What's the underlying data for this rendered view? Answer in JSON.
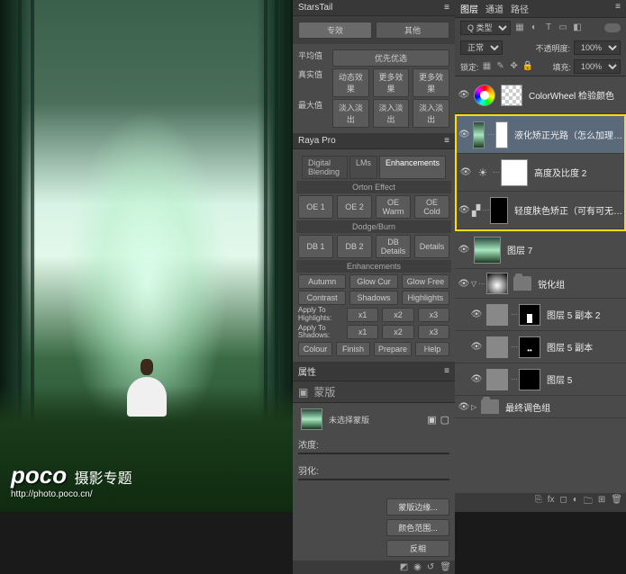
{
  "watermark": {
    "brand": "poco",
    "topic": "摄影专题",
    "url": "http://photo.poco.cn/"
  },
  "starstail": {
    "title": "StarsTail",
    "tabs": [
      "专效",
      "其他"
    ],
    "rows": {
      "row1": [
        "平均值",
        "优先优选"
      ],
      "row2": [
        "真实值",
        "动态效果",
        "更多效果",
        "更多效果"
      ],
      "row3": [
        "最大值",
        "淡入淡出",
        "淡入淡出",
        "淡入淡出"
      ]
    }
  },
  "raya": {
    "title": "Raya Pro",
    "tabs": {
      "t1": "Digital Blending",
      "t2": "LMs",
      "t3": "Enhancements"
    },
    "orton": {
      "title": "Orton Effect",
      "btns": [
        "OE 1",
        "OE 2",
        "OE Warm",
        "OE Cold"
      ]
    },
    "dodge": {
      "title": "Dodge/Burn",
      "btns": [
        "DB 1",
        "DB 2",
        "DB Details",
        "Details"
      ]
    },
    "enh": {
      "title": "Enhancements",
      "btns": [
        "Autumn",
        "Glow Cur",
        "Glow Free"
      ],
      "btns2": [
        "Contrast",
        "Shadows",
        "Highlights"
      ]
    },
    "apply": {
      "hl_label": "Apply To\nHighlights:",
      "sh_label": "Apply To\nShadows:",
      "levels": [
        "x1",
        "x2",
        "x3"
      ]
    },
    "bottom": [
      "Colour",
      "Finish",
      "Prepare",
      "Help"
    ]
  },
  "properties": {
    "title": "属性",
    "mask_label": "蒙版",
    "name": "未选择蒙版",
    "density": "浓度:",
    "feather": "羽化:",
    "foot": {
      "b1": "蒙版边缘...",
      "b2": "颜色范围...",
      "b3": "反相"
    }
  },
  "layers": {
    "tabs": {
      "t1": "图层",
      "t2": "通道",
      "t3": "路径"
    },
    "filter_kind": "Q 类型",
    "blend_mode": "正常",
    "opacity_label": "不透明度:",
    "opacity_value": "100%",
    "lock_label": "锁定:",
    "fill_label": "填充:",
    "fill_value": "100%",
    "items": {
      "colorwheel": "ColorWheel 检验颜色",
      "l1": "液化矫正光路（怎么加理…",
      "l2": "高度及比度 2",
      "l3": "轻度肤色矫正（可有可无…",
      "l4": "图层 7",
      "group": "锐化组",
      "l5": "图层 5 副本 2",
      "l6": "图层 5 副本",
      "l7": "图层 5"
    },
    "footer_text": "最终调色组"
  }
}
